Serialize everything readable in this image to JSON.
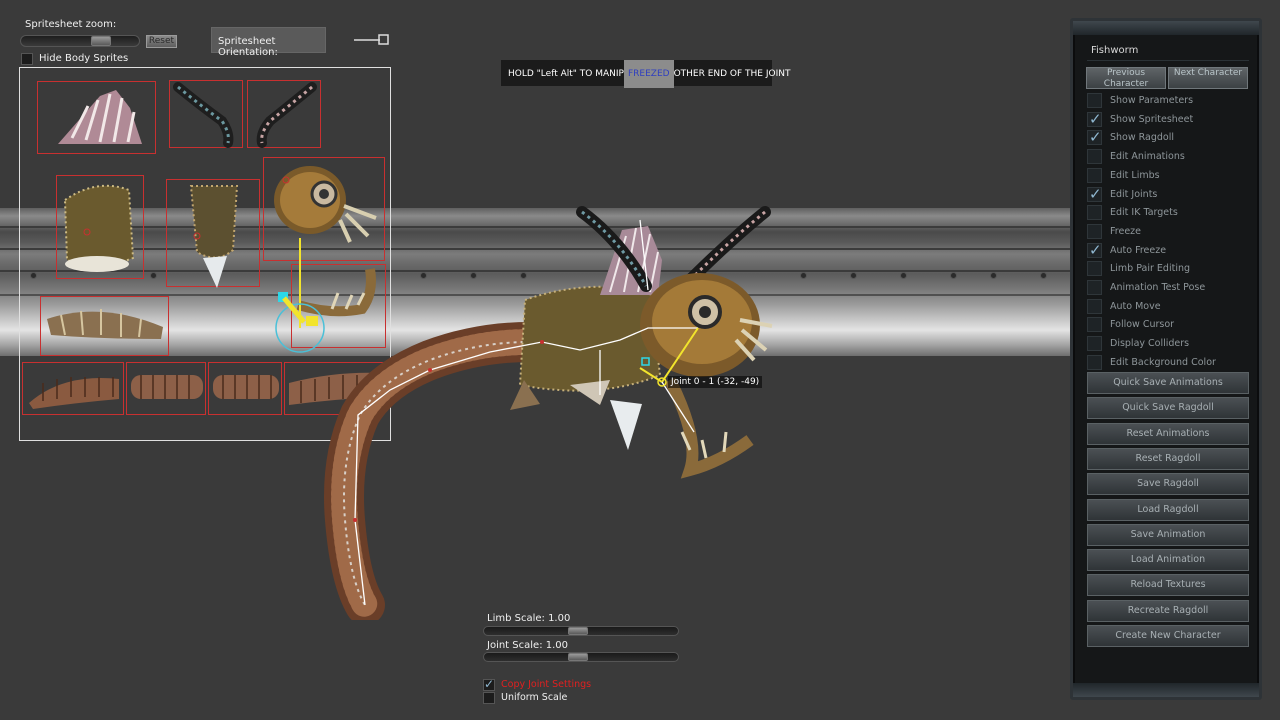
{
  "sprite_controls": {
    "zoom_label": "Spritesheet zoom:",
    "reset_label": "Reset",
    "hide_body_label": "Hide Body Sprites",
    "orientation_label": "Spritesheet Orientation:"
  },
  "hint": {
    "before": "HOLD \"Left Alt\" TO MANIP",
    "highlight": "FREEZED",
    "after": "OTHER END OF THE JOINT"
  },
  "joint_readout": "Joint 0 - 1 (-32, -49)",
  "bottom": {
    "limb_scale_label": "Limb Scale: 1.00",
    "joint_scale_label": "Joint Scale: 1.00",
    "copy_joint_label": "Copy Joint Settings",
    "uniform_scale_label": "Uniform Scale"
  },
  "panel": {
    "title": "Fishworm",
    "prev_label": "Previous Character",
    "next_label": "Next Character",
    "options": [
      {
        "label": "Show Parameters",
        "checked": false
      },
      {
        "label": "Show Spritesheet",
        "checked": true
      },
      {
        "label": "Show Ragdoll",
        "checked": true
      },
      {
        "label": "Edit Animations",
        "checked": false
      },
      {
        "label": "Edit Limbs",
        "checked": false
      },
      {
        "label": "Edit Joints",
        "checked": true
      },
      {
        "label": "Edit IK Targets",
        "checked": false
      },
      {
        "label": "Freeze",
        "checked": false
      },
      {
        "label": "Auto Freeze",
        "checked": true
      },
      {
        "label": "Limb Pair Editing",
        "checked": false
      },
      {
        "label": "Animation Test Pose",
        "checked": false
      },
      {
        "label": "Auto Move",
        "checked": false
      },
      {
        "label": "Follow Cursor",
        "checked": false
      },
      {
        "label": "Display Colliders",
        "checked": false
      },
      {
        "label": "Edit Background Color",
        "checked": false
      }
    ],
    "actions": [
      "Quick Save Animations",
      "Quick Save Ragdoll",
      "Reset Animations",
      "Reset Ragdoll",
      "Save Ragdoll",
      "Load Ragdoll",
      "Save Animation",
      "Load Animation",
      "Reload Textures",
      "Recreate Ragdoll",
      "Create New Character"
    ]
  }
}
